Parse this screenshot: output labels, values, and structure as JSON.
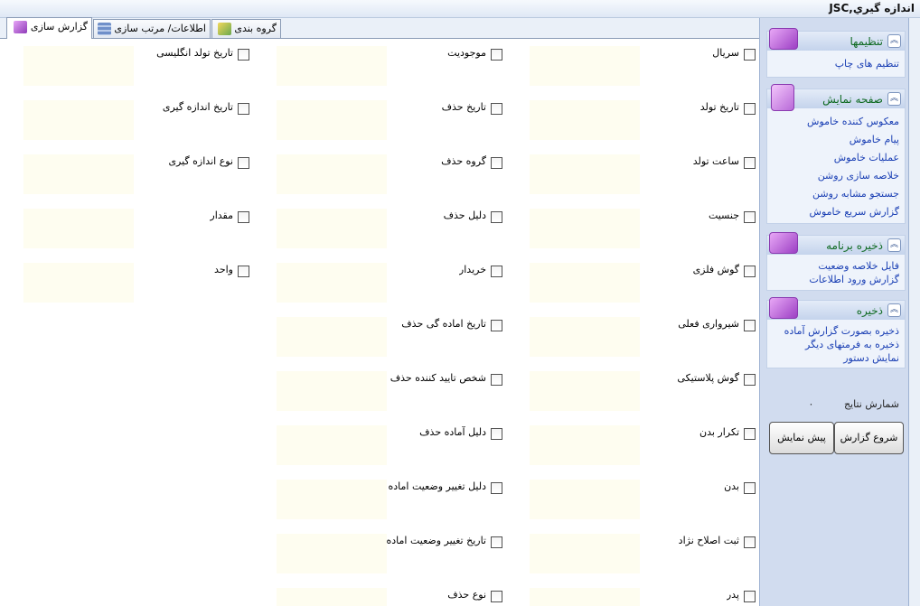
{
  "window": {
    "title": "اندازه گيري,JSC"
  },
  "tabs": [
    {
      "label": "گزارش سازی",
      "icon": "report-icon",
      "active": true
    },
    {
      "label": "اطلاعات/ مرتب سازی",
      "icon": "database-icon",
      "active": false
    },
    {
      "label": "گروه بندی",
      "icon": "group-icon",
      "active": false
    }
  ],
  "columns": [
    {
      "fields": [
        "سريال",
        "تاريخ تولد",
        "ساعت تولد",
        "جنسيت",
        "گوش فلزی",
        "شيرواری فعلی",
        "گوش پلاستيکی",
        "تکرار بدن",
        "بدن",
        "ثبت اصلاح نژاد",
        "پدر"
      ]
    },
    {
      "fields": [
        "موجوديت",
        "تاريخ حذف",
        "گروه حذف",
        "دليل حذف",
        "خريدار",
        "تاريخ اماده گی حذف",
        "شخص تاييد کننده حذف",
        "دليل آماده حذف",
        "دليل تغيير وضعيت  اماده",
        "تاريخ تغيير وضعيت  اماده",
        "نوع حذف"
      ]
    },
    {
      "fields": [
        "تاريخ تولد انگليسی",
        "تاريخ اندازه گيری",
        "نوع اندازه گيری",
        "مقدار",
        "واحد"
      ]
    }
  ],
  "sidebar": {
    "groups": [
      {
        "title": "تنظيمها",
        "icon": "settings-gear-icon",
        "links": [
          "تنظيم های چاپ"
        ]
      },
      {
        "title": "صفحه نمايش",
        "icon": "display-icon",
        "links": [
          "معکوس کننده خاموش",
          "پيام خاموش",
          "عمليات خاموش",
          "خلاصه سازی روشن",
          "جستجو مشابه روشن",
          "گزارش سريع خاموش"
        ]
      },
      {
        "title": "ذخيره برنامه",
        "icon": "folder-icon",
        "links": [
          "فايل خلاصه وضعيت",
          "گزارش ورود اطلاعات"
        ]
      },
      {
        "title": "ذخيره",
        "icon": "save-disk-icon",
        "links": [
          "ذخيره بصورت گزارش آماده",
          "ذخيره به فرمتهای ديگر",
          "نمايش دستور"
        ]
      }
    ],
    "results_label": "شمارش نتايج",
    "results_value": "٠",
    "start_button": "شروع گزارش",
    "preview_button": "پيش نمايش"
  }
}
